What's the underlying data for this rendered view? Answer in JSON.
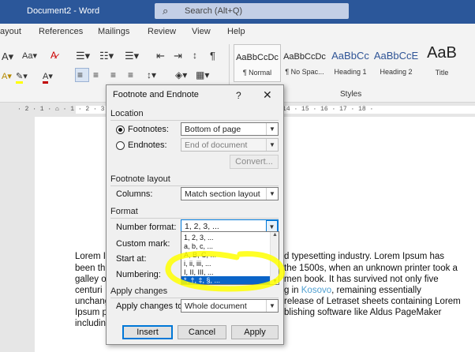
{
  "titlebar": {
    "document": "Document2  -  Word",
    "search_placeholder": "Search (Alt+Q)"
  },
  "tabs": [
    "ayout",
    "References",
    "Mailings",
    "Review",
    "View",
    "Help"
  ],
  "ribbon": {
    "font_size_label": "Aa",
    "font_color_glyph": "A",
    "pilcrow": "¶",
    "styles_group_label": "Styles",
    "styles": [
      {
        "sample": "AaBbCcDc",
        "name": "¶ Normal"
      },
      {
        "sample": "AaBbCcDc",
        "name": "¶ No Spac..."
      },
      {
        "sample": "AaBbCc",
        "name": "Heading 1"
      },
      {
        "sample": "AaBbCcE",
        "name": "Heading 2"
      },
      {
        "sample": "AaB",
        "name": "Title"
      }
    ]
  },
  "ruler": "· 2 · 1 · ⌂ · 1 · 2 · 3 · 4 · 5 · 6 · 7 · 8 · 9 · 10 · 11 · 12 · 13 · 14 · 15 · 16 · 17 · 18 ·",
  "document": {
    "lines": [
      {
        "a": "Lorem I",
        "b": "d typesetting industry. Lorem Ipsum has"
      },
      {
        "a": "been th",
        "b": "the 1500s, when an unknown printer took a"
      },
      {
        "a": "galley o",
        "b": "men book. It has survived not only five"
      },
      {
        "a": "centuri",
        "b_pre": "g in ",
        "b_link": "Kosovo",
        "b_post": ", remaining essentially"
      },
      {
        "a": "unchang",
        "b": "release of Letraset sheets containing Lorem"
      },
      {
        "a": "Ipsum p",
        "b": "blishing software like Aldus PageMaker"
      },
      {
        "a": "includin",
        "b": ""
      }
    ]
  },
  "dialog": {
    "title": "Footnote and Endnote",
    "help": "?",
    "close": "✕",
    "location_heading": "Location",
    "footnotes_label": "Footnotes:",
    "footnotes_value": "Bottom of page",
    "endnotes_label": "Endnotes:",
    "endnotes_value": "End of document",
    "convert_label": "Convert...",
    "layout_heading": "Footnote layout",
    "columns_label": "Columns:",
    "columns_value": "Match section layout",
    "format_heading": "Format",
    "number_format_label": "Number format:",
    "number_format_value": "1, 2, 3, ...",
    "custom_mark_label": "Custom mark:",
    "start_at_label": "Start at:",
    "numbering_label": "Numbering:",
    "apply_heading": "Apply changes",
    "apply_to_label": "Apply changes to:",
    "apply_to_value": "Whole document",
    "insert_label": "Insert",
    "cancel_label": "Cancel",
    "apply_label": "Apply",
    "number_format_options": [
      "1, 2, 3, ...",
      "a, b, c, ...",
      "A, B, C, ...",
      "i, ii, iii, ...",
      "I, II, III, ...",
      "*, †, ‡, §, ..."
    ],
    "selected_option_index": 5
  },
  "colors": {
    "titlebar": "#2b579a",
    "accent": "#0078d7",
    "highlight_marker": "#ffff00",
    "link": "#4f9fd0"
  }
}
